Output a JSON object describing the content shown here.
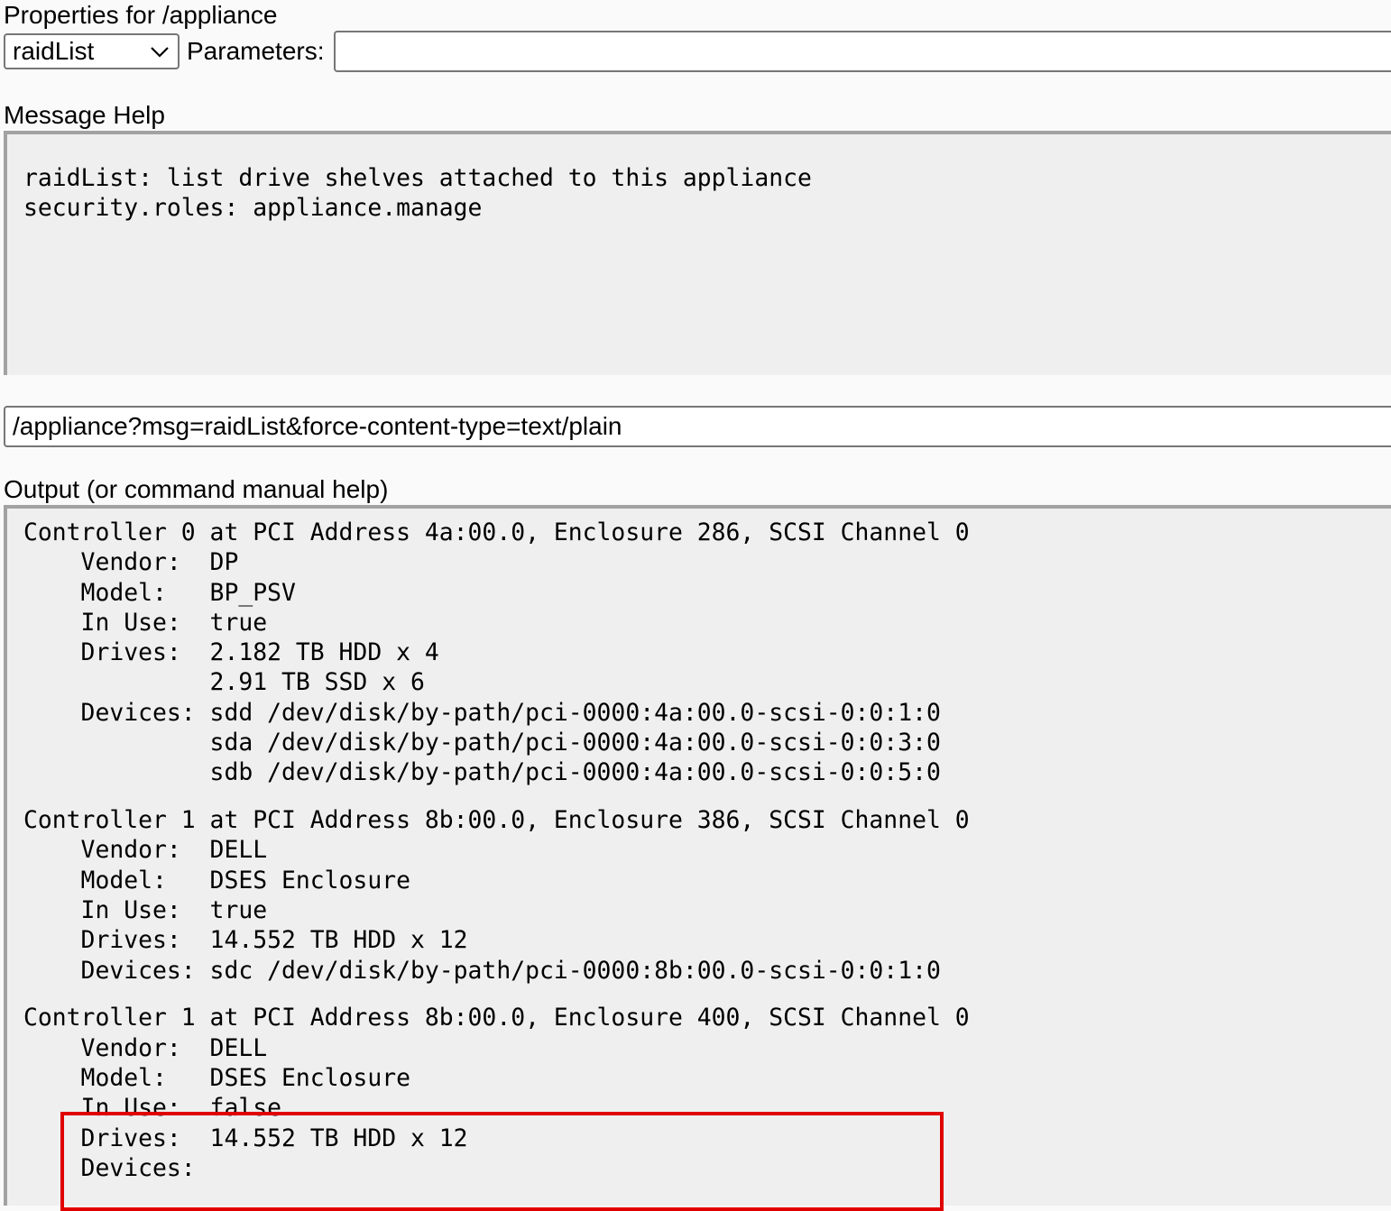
{
  "header": {
    "title": "Properties for /appliance",
    "method_select": {
      "value": "raidList"
    },
    "parameters_label": "Parameters:",
    "parameters_value": ""
  },
  "message_help": {
    "title": "Message Help",
    "lines": [
      "raidList: list drive shelves attached to this appliance",
      "security.roles: appliance.manage"
    ]
  },
  "url_bar": {
    "value": "/appliance?msg=raidList&force-content-type=text/plain"
  },
  "output": {
    "title": "Output (or command manual help)",
    "controllers": [
      {
        "lines": [
          "Controller 0 at PCI Address 4a:00.0, Enclosure 286, SCSI Channel 0",
          "    Vendor:  DP",
          "    Model:   BP_PSV",
          "    In Use:  true",
          "    Drives:  2.182 TB HDD x 4",
          "             2.91 TB SSD x 6",
          "    Devices: sdd /dev/disk/by-path/pci-0000:4a:00.0-scsi-0:0:1:0",
          "             sda /dev/disk/by-path/pci-0000:4a:00.0-scsi-0:0:3:0",
          "             sdb /dev/disk/by-path/pci-0000:4a:00.0-scsi-0:0:5:0"
        ]
      },
      {
        "lines": [
          "Controller 1 at PCI Address 8b:00.0, Enclosure 386, SCSI Channel 0",
          "    Vendor:  DELL",
          "    Model:   DSES Enclosure",
          "    In Use:  true",
          "    Drives:  14.552 TB HDD x 12",
          "    Devices: sdc /dev/disk/by-path/pci-0000:8b:00.0-scsi-0:0:1:0"
        ]
      },
      {
        "lines": [
          "Controller 1 at PCI Address 8b:00.0, Enclosure 400, SCSI Channel 0",
          "    Vendor:  DELL",
          "    Model:   DSES Enclosure",
          "    In Use:  false",
          "    Drives:  14.552 TB HDD x 12",
          "    Devices:"
        ]
      }
    ]
  },
  "colors": {
    "highlight": "#e00000",
    "panel_background": "#efefef"
  }
}
